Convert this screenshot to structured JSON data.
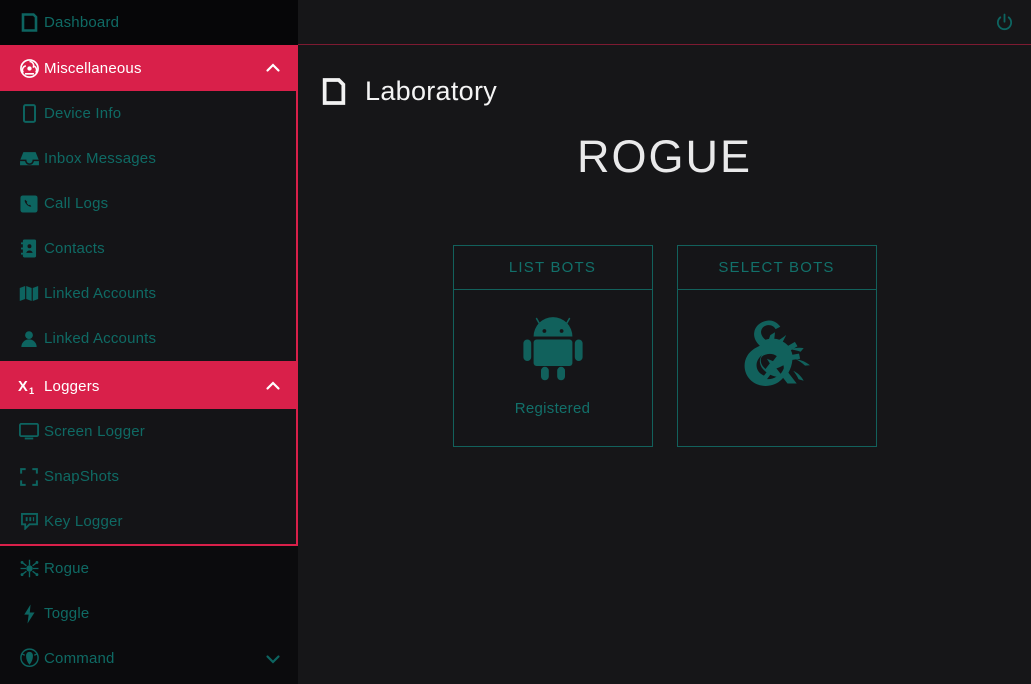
{
  "colors": {
    "accent_red": "#d9204a",
    "teal": "#0f6a64",
    "teal_bright": "#12706a",
    "sidebar_bg": "#0b0b0d",
    "sub_bg": "#141417",
    "main_bg": "#161618",
    "text_white": "#f4f4f4"
  },
  "sidebar": {
    "root_item": {
      "label": "Dashboard",
      "icon": "mobile-device-icon"
    },
    "groups": [
      {
        "label": "Miscellaneous",
        "icon": "biohazard-icon",
        "chevron": "chevron-up-icon",
        "expanded": true,
        "items": [
          {
            "label": "Device Info",
            "icon": "mobile-phone-icon"
          },
          {
            "label": "Inbox Messages",
            "icon": "inbox-icon"
          },
          {
            "label": "Call Logs",
            "icon": "phone-call-icon"
          },
          {
            "label": "Contacts",
            "icon": "address-book-icon"
          },
          {
            "label": "Linked Accounts",
            "icon": "user-icon"
          }
        ]
      },
      {
        "label": "Loggers",
        "icon": "x-subscript-one-icon",
        "chevron": "chevron-up-icon",
        "expanded": true,
        "items": [
          {
            "label": "Screen Logger",
            "icon": "monitor-icon"
          },
          {
            "label": "SnapShots",
            "icon": "expand-frame-icon"
          },
          {
            "label": "Key Logger",
            "icon": "keyboard-chat-icon"
          }
        ]
      }
    ],
    "plain_items": [
      {
        "label": "Rogue",
        "icon": "spider-virus-icon",
        "chevron": null
      },
      {
        "label": "Toggle",
        "icon": "lightning-bolt-icon",
        "chevron": null
      },
      {
        "label": "Command",
        "icon": "shielded-figure-icon",
        "chevron": "chevron-down-icon"
      }
    ]
  },
  "topbar": {
    "power_icon": "power-icon"
  },
  "page": {
    "header_icon": "mobile-device-icon",
    "header_title": "Laboratory",
    "big_title": "ROGUE"
  },
  "cards": [
    {
      "title": "LIST BOTS",
      "icon": "android-robot-icon",
      "status": "Registered"
    },
    {
      "title": "SELECT BOTS",
      "icon": "dragon-ampersand-icon",
      "status": ""
    }
  ]
}
